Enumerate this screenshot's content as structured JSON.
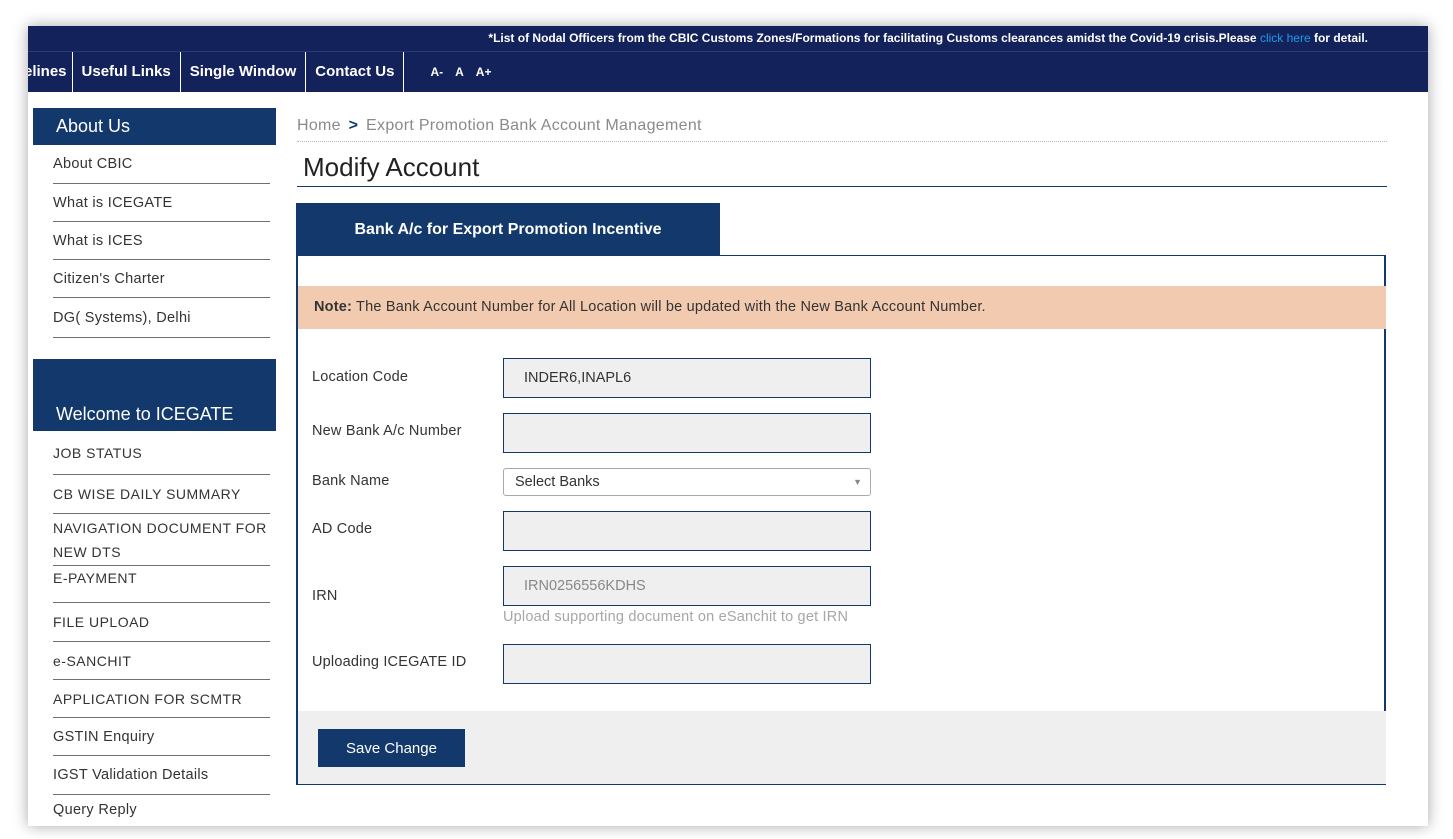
{
  "ticker": {
    "text": "*List of Nodal Officers from the CBIC Customs Zones/Formations for facilitating Customs clearances amidst the Covid-19 crisis.Please",
    "link_text": "click here",
    "suffix": "for detail."
  },
  "nav": {
    "items": [
      "elines",
      "Useful Links",
      "Single Window",
      "Contact Us"
    ],
    "font_controls": [
      "A-",
      "A",
      "A+"
    ]
  },
  "sidebar": {
    "about_title": "About Us",
    "about_items": [
      "About CBIC",
      "What is ICEGATE",
      "What is ICES",
      "Citizen's Charter",
      "DG( Systems), Delhi"
    ],
    "welcome_title": "Welcome to ICEGATE",
    "welcome_items": [
      "JOB STATUS",
      "CB WISE DAILY SUMMARY",
      "NAVIGATION DOCUMENT FOR NEW DTS",
      "E-PAYMENT",
      "FILE UPLOAD",
      "e-SANCHIT",
      "APPLICATION FOR SCMTR",
      "GSTIN Enquiry",
      "IGST Validation Details",
      "Query Reply"
    ]
  },
  "breadcrumb": {
    "home": "Home",
    "separator": ">",
    "current": "Export Promotion Bank Account Management"
  },
  "page_title": "Modify Account",
  "tab_label": "Bank A/c for Export Promotion Incentive",
  "note": {
    "prefix": "Note:",
    "text": "The Bank Account Number for All Location will be updated with the New Bank Account Number."
  },
  "form": {
    "location_code_label": "Location Code",
    "location_code_value": "INDER6,INAPL6",
    "new_account_label": "New Bank A/c Number",
    "new_account_value": "",
    "bank_name_label": "Bank Name",
    "bank_name_value": "Select Banks",
    "ad_code_label": "AD Code",
    "ad_code_value": "",
    "irn_label": "IRN",
    "irn_value": "IRN0256556KDHS",
    "irn_hint": "Upload supporting document on eSanchit to get IRN",
    "uploading_id_label": "Uploading ICEGATE ID",
    "uploading_id_value": ""
  },
  "save_button_label": "Save Change",
  "colors": {
    "navy": "#13225a",
    "brand_blue": "#13386b",
    "note_bg": "#f2cab0",
    "link": "#1f9be8"
  }
}
